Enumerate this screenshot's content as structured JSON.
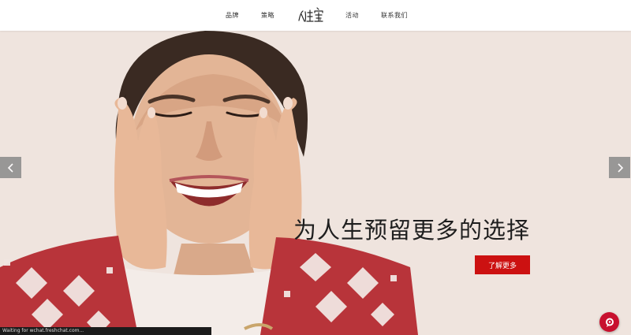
{
  "nav": {
    "items": [
      {
        "label": "品牌"
      },
      {
        "label": "策略"
      },
      {
        "label": "活动"
      },
      {
        "label": "联系我们"
      }
    ],
    "logo_text": "优生宝"
  },
  "hero": {
    "headline": "为人生预留更多的选择",
    "cta_label": "了解更多",
    "photo_icon": "smiling-woman-photo"
  },
  "carousel": {
    "prev_icon": "chevron-left-icon",
    "next_icon": "chevron-right-icon"
  },
  "status_bar": {
    "text": "Waiting for wchat.freshchat.com..."
  },
  "chat": {
    "icon": "chat-icon"
  },
  "colors": {
    "accent": "#cc1111",
    "nav_bg": "#ffffff",
    "hero_bg": "#efe4de"
  }
}
